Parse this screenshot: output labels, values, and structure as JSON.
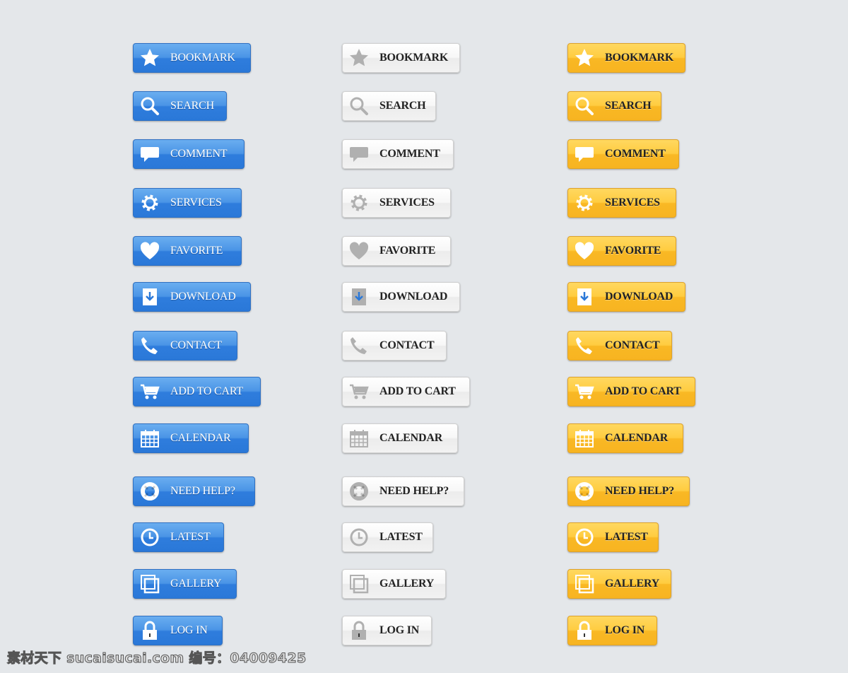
{
  "colors": {
    "blue": "#2f7ddd",
    "white": "#f2f2f2",
    "yellow": "#f9b824",
    "icon_white": "#ffffff",
    "icon_gray": "#b0b0b0"
  },
  "buttons": [
    {
      "label": "BOOKMARK",
      "icon": "star-icon"
    },
    {
      "label": "SEARCH",
      "icon": "search-icon"
    },
    {
      "label": "COMMENT",
      "icon": "comment-icon"
    },
    {
      "label": "SERVICES",
      "icon": "gear-icon"
    },
    {
      "label": "FAVORITE",
      "icon": "heart-icon"
    },
    {
      "label": "DOWNLOAD",
      "icon": "download-icon"
    },
    {
      "label": "CONTACT",
      "icon": "phone-icon"
    },
    {
      "label": "ADD TO CART",
      "icon": "cart-icon"
    },
    {
      "label": "CALENDAR",
      "icon": "calendar-icon"
    },
    {
      "label": "NEED HELP?",
      "icon": "lifebuoy-icon"
    },
    {
      "label": "LATEST",
      "icon": "clock-icon"
    },
    {
      "label": "GALLERY",
      "icon": "gallery-icon"
    },
    {
      "label": "LOG IN",
      "icon": "lock-icon"
    }
  ],
  "styles": [
    "blue",
    "white",
    "yellow"
  ],
  "watermark": "素材天下 sucaisucai.com  编号：04009425"
}
